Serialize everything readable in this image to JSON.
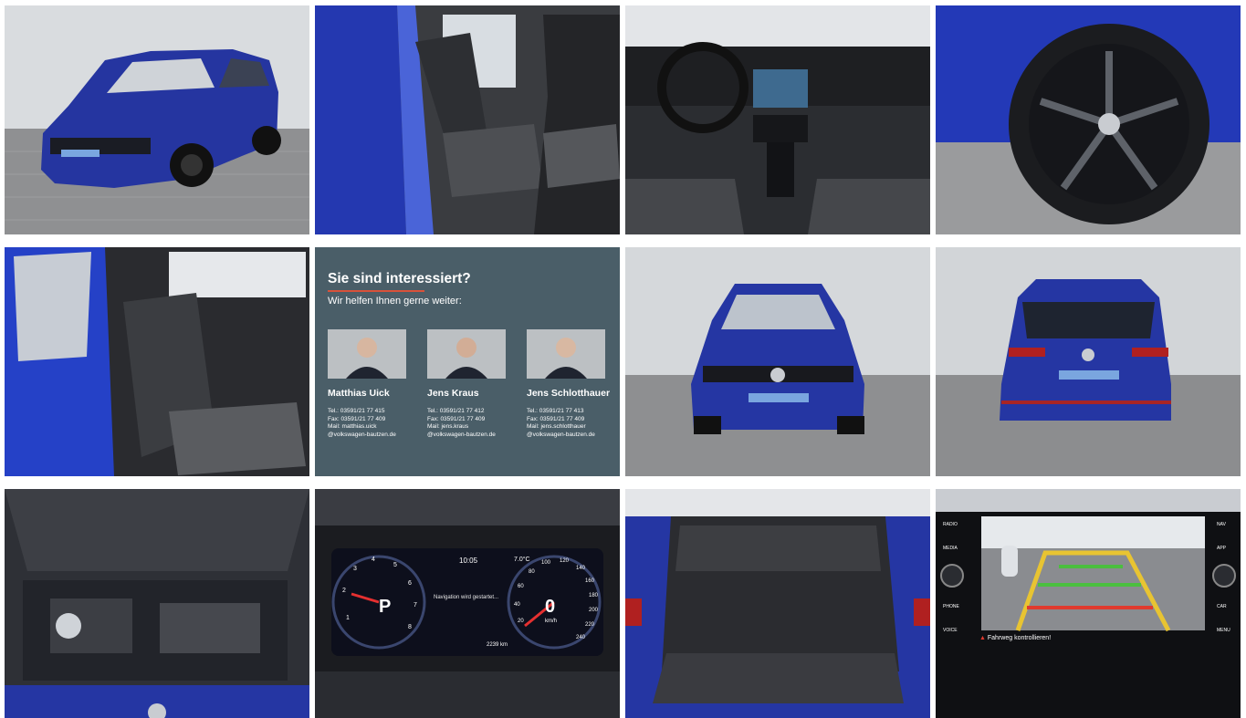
{
  "gallery": {
    "tiles": [
      {
        "name": "photo-front-three-quarter"
      },
      {
        "name": "photo-front-seats"
      },
      {
        "name": "photo-dashboard"
      },
      {
        "name": "photo-wheel"
      },
      {
        "name": "photo-rear-seats"
      },
      {
        "name": "contact-card"
      },
      {
        "name": "photo-front"
      },
      {
        "name": "photo-rear"
      },
      {
        "name": "photo-engine-bay"
      },
      {
        "name": "photo-instrument-cluster"
      },
      {
        "name": "photo-trunk"
      },
      {
        "name": "photo-rear-camera-screen"
      }
    ]
  },
  "contact": {
    "title": "Sie sind interessiert?",
    "subtitle": "Wir helfen Ihnen gerne weiter:",
    "people": [
      {
        "name": "Matthias Uick",
        "tel": "Tel.:  03591/21 77 415",
        "fax": "Fax:  03591/21 77 409",
        "mail": "Mail:  matthias.uick",
        "domain": "@volkswagen-bautzen.de"
      },
      {
        "name": "Jens Kraus",
        "tel": "Tel.:  03591/21 77 412",
        "fax": "Fax:  03591/21 77 409",
        "mail": "Mail:  jens.kraus",
        "domain": "@volkswagen-bautzen.de"
      },
      {
        "name": "Jens Schlotthauer",
        "tel": "Tel.:  03591/21 77 413",
        "fax": "Fax:  03591/21 77 409",
        "mail": "Mail:  jens.schlotthauer",
        "domain": "@volkswagen-bautzen.de"
      }
    ]
  },
  "cluster": {
    "time": "10:05",
    "temp": "7.0°C",
    "gear": "P",
    "speed": "0",
    "speed_unit": "km/h",
    "nav_message": "Navigation wird gestartet...",
    "odometer": "2239 km",
    "tach_ticks": [
      "1",
      "2",
      "3",
      "4",
      "5",
      "6",
      "7",
      "8"
    ],
    "speed_ticks": [
      "20",
      "40",
      "60",
      "80",
      "100",
      "120",
      "140",
      "160",
      "180",
      "200",
      "220",
      "240"
    ]
  },
  "camera": {
    "left_buttons": [
      "RADIO",
      "MEDIA",
      "PHONE",
      "VOICE"
    ],
    "right_buttons": [
      "NAV",
      "APP",
      "CAR",
      "MENU"
    ],
    "warning": "Fahrweg kontrollieren!"
  },
  "colors": {
    "car_blue": "#2535a0",
    "contact_bg": "#4a5e68",
    "accent": "#d9523a"
  }
}
